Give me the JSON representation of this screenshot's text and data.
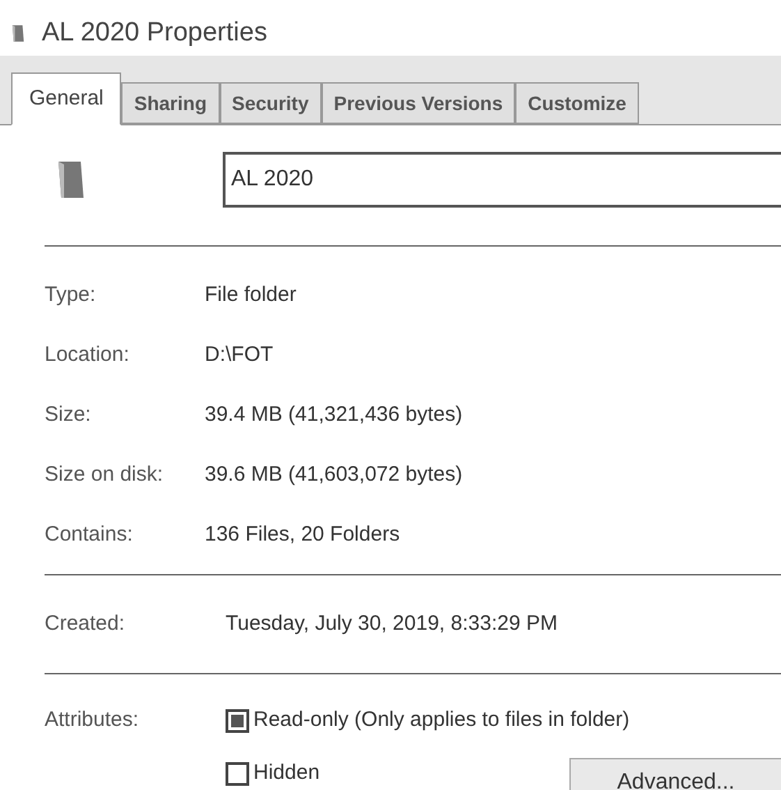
{
  "window": {
    "title": "AL 2020 Properties"
  },
  "tabs": [
    {
      "label": "General",
      "selected": true
    },
    {
      "label": "Sharing",
      "selected": false
    },
    {
      "label": "Security",
      "selected": false
    },
    {
      "label": "Previous Versions",
      "selected": false
    },
    {
      "label": "Customize",
      "selected": false
    }
  ],
  "name_field": {
    "value": "AL 2020"
  },
  "details": [
    {
      "label": "Type:",
      "value": "File folder"
    },
    {
      "label": "Location:",
      "value": "D:\\FOT"
    },
    {
      "label": "Size:",
      "value": "39.4 MB (41,321,436 bytes)"
    },
    {
      "label": "Size on disk:",
      "value": "39.6 MB (41,603,072 bytes)"
    },
    {
      "label": "Contains:",
      "value": "136 Files, 20 Folders"
    }
  ],
  "created": {
    "label": "Created:",
    "value": "Tuesday, July 30, 2019, 8:33:29 PM"
  },
  "attributes": {
    "label": "Attributes:",
    "options": [
      {
        "label": "Read-only (Only applies to files in folder)",
        "checked": false,
        "indeterminate": true
      },
      {
        "label": "Hidden",
        "checked": false,
        "indeterminate": false
      }
    ],
    "button": "Advanced..."
  }
}
